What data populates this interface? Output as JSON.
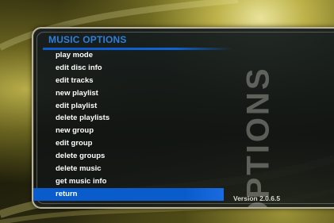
{
  "header": {
    "title": "MUSIC OPTIONS"
  },
  "menu": {
    "items": [
      {
        "label": "play mode"
      },
      {
        "label": "edit disc info"
      },
      {
        "label": "edit tracks"
      },
      {
        "label": "new playlist"
      },
      {
        "label": "edit playlist"
      },
      {
        "label": "delete playlists"
      },
      {
        "label": "new group"
      },
      {
        "label": "edit group"
      },
      {
        "label": "delete groups"
      },
      {
        "label": "delete music"
      },
      {
        "label": "get music info"
      },
      {
        "label": "return",
        "selected": true
      }
    ]
  },
  "watermark": "OPTIONS",
  "version": "Version 2.0.6.5",
  "colors": {
    "accent": "#0a5ccc",
    "title": "#2f7fd6",
    "text": "#ffffff"
  }
}
